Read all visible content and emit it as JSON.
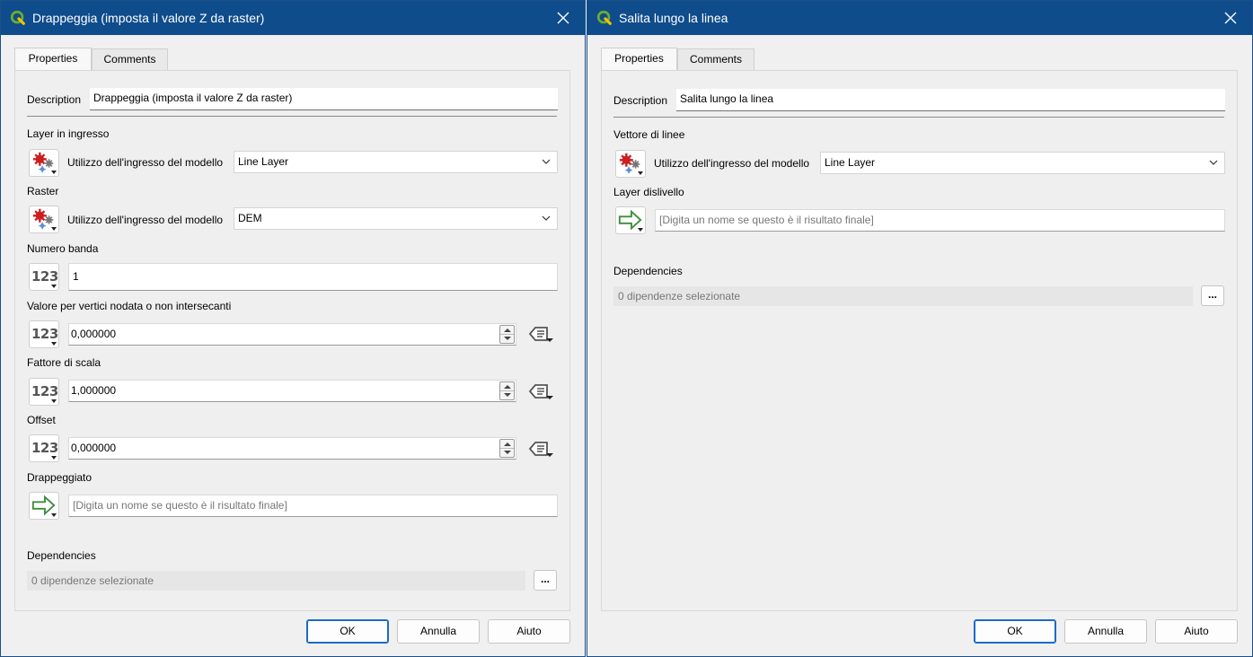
{
  "colors": {
    "titlebar": "#0f4c8c",
    "qgis_green": "#6cae2b",
    "qgis_yellow": "#f2c200",
    "ok_border": "#1b6ac9",
    "model_input_red": "#cc1e1e",
    "output_arrow_green": "#3e8e3a"
  },
  "left": {
    "title": "Drappeggia (imposta il valore Z da raster)",
    "tabs": [
      "Properties",
      "Comments"
    ],
    "description_label": "Description",
    "description_value": "Drappeggia (imposta il valore Z da raster)",
    "input_layer": {
      "label": "Layer in ingresso",
      "source_label": "Utilizzo dell'ingresso del modello",
      "value": "Line Layer"
    },
    "raster": {
      "label": "Raster",
      "source_label": "Utilizzo dell'ingresso del modello",
      "value": "DEM"
    },
    "band": {
      "label": "Numero banda",
      "icon_text": "123",
      "value": "1"
    },
    "nodata": {
      "label": "Valore per vertici nodata o non intersecanti",
      "icon_text": "123",
      "value": "0,000000"
    },
    "scale": {
      "label": "Fattore di scala",
      "icon_text": "123",
      "value": "1,000000"
    },
    "offset": {
      "label": "Offset",
      "icon_text": "123",
      "value": "0,000000"
    },
    "output": {
      "label": "Drappeggiato",
      "placeholder": "[Digita un nome se questo è il risultato finale]"
    },
    "dependencies": {
      "label": "Dependencies",
      "value": "0 dipendenze selezionate",
      "button": "..."
    },
    "buttons": {
      "ok": "OK",
      "cancel": "Annulla",
      "help": "Aiuto"
    }
  },
  "right": {
    "title": "Salita lungo la linea",
    "tabs": [
      "Properties",
      "Comments"
    ],
    "description_label": "Description",
    "description_value": "Salita lungo la linea",
    "line_vector": {
      "label": "Vettore di linee",
      "source_label": "Utilizzo dell'ingresso del modello",
      "value": "Line Layer"
    },
    "output": {
      "label": "Layer dislivello",
      "placeholder": "[Digita un nome se questo è il risultato finale]"
    },
    "dependencies": {
      "label": "Dependencies",
      "value": "0 dipendenze selezionate",
      "button": "..."
    },
    "buttons": {
      "ok": "OK",
      "cancel": "Annulla",
      "help": "Aiuto"
    }
  }
}
